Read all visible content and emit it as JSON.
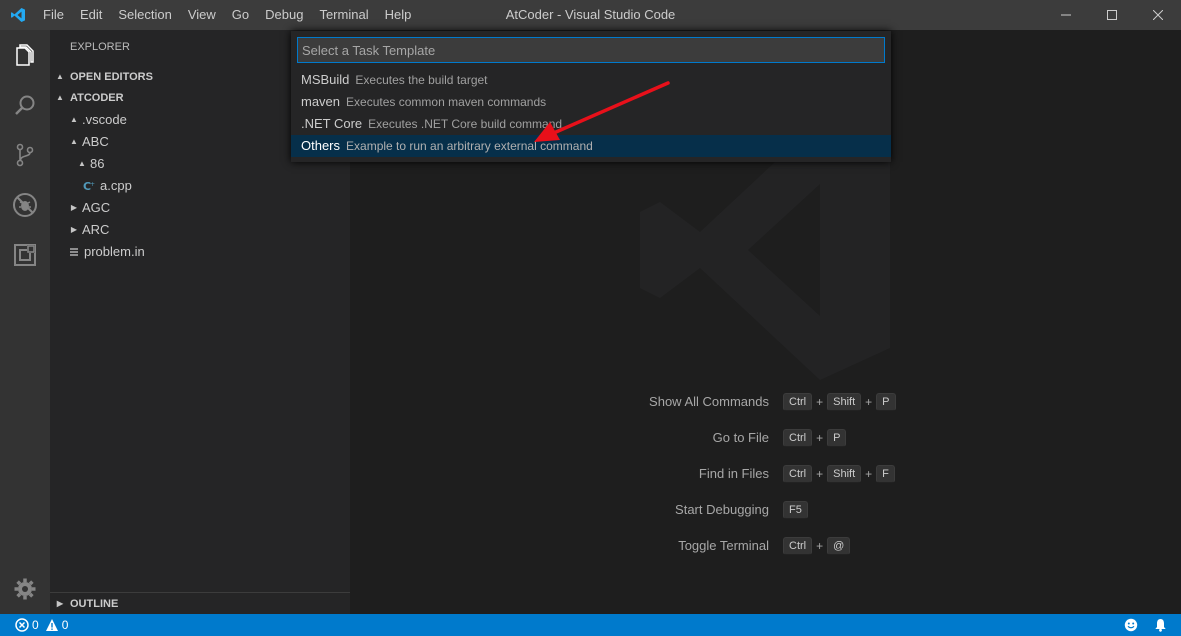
{
  "window": {
    "title": "AtCoder - Visual Studio Code"
  },
  "menu": [
    "File",
    "Edit",
    "Selection",
    "View",
    "Go",
    "Debug",
    "Terminal",
    "Help"
  ],
  "sidebar": {
    "title": "EXPLORER",
    "open_editors": "OPEN EDITORS",
    "folder": "ATCODER",
    "tree": [
      {
        "label": ".vscode",
        "depth": 1,
        "twist": "▲"
      },
      {
        "label": "ABC",
        "depth": 1,
        "twist": "▲"
      },
      {
        "label": "86",
        "depth": 2,
        "twist": "▲"
      },
      {
        "label": "a.cpp",
        "depth": 3,
        "twist": "",
        "icon": "cpp-file-icon"
      },
      {
        "label": "AGC",
        "depth": 1,
        "twist": "▶"
      },
      {
        "label": "ARC",
        "depth": 1,
        "twist": "▶"
      },
      {
        "label": "problem.in",
        "depth": 1,
        "twist": "",
        "icon": "text-file-icon"
      }
    ],
    "outline": "OUTLINE"
  },
  "quickpick": {
    "placeholder": "Select a Task Template",
    "items": [
      {
        "label": "MSBuild",
        "description": "Executes the build target"
      },
      {
        "label": "maven",
        "description": "Executes common maven commands"
      },
      {
        "label": ".NET Core",
        "description": "Executes .NET Core build command"
      },
      {
        "label": "Others",
        "description": "Example to run an arbitrary external command",
        "selected": true
      }
    ]
  },
  "shortcuts": [
    {
      "label": "Show All Commands",
      "keys": [
        "Ctrl",
        "Shift",
        "P"
      ]
    },
    {
      "label": "Go to File",
      "keys": [
        "Ctrl",
        "P"
      ]
    },
    {
      "label": "Find in Files",
      "keys": [
        "Ctrl",
        "Shift",
        "F"
      ]
    },
    {
      "label": "Start Debugging",
      "keys": [
        "F5"
      ]
    },
    {
      "label": "Toggle Terminal",
      "keys": [
        "Ctrl",
        "@"
      ]
    }
  ],
  "statusbar": {
    "errors": "0",
    "warnings": "0"
  },
  "colors": {
    "accent": "#007acc",
    "selection": "#062f4a",
    "arrow": "#e8101a"
  }
}
